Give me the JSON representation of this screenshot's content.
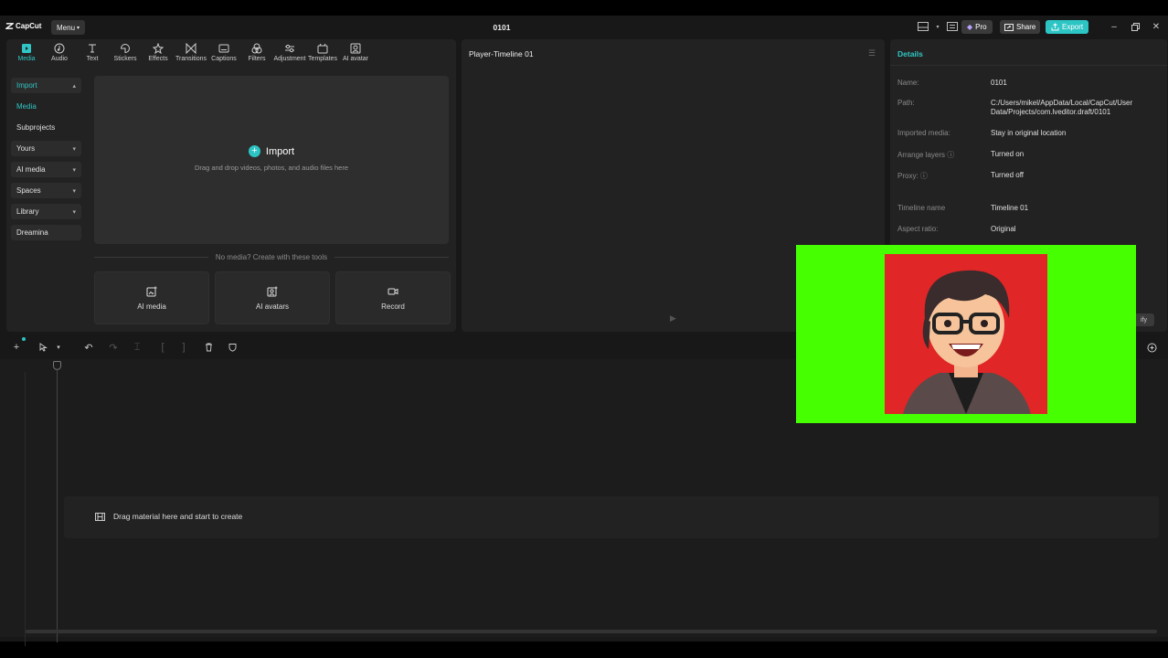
{
  "app": {
    "logo_text": "CapCut",
    "menu_label": "Menu",
    "project_title": "0101",
    "pro_label": "Pro",
    "share_label": "Share",
    "export_label": "Export"
  },
  "toolbar": {
    "items": [
      {
        "label": "Media",
        "icon": "media-icon"
      },
      {
        "label": "Audio",
        "icon": "audio-icon"
      },
      {
        "label": "Text",
        "icon": "text-icon"
      },
      {
        "label": "Stickers",
        "icon": "stickers-icon"
      },
      {
        "label": "Effects",
        "icon": "effects-icon"
      },
      {
        "label": "Transitions",
        "icon": "transitions-icon"
      },
      {
        "label": "Captions",
        "icon": "captions-icon"
      },
      {
        "label": "Filters",
        "icon": "filters-icon"
      },
      {
        "label": "Adjustment",
        "icon": "adjustment-icon"
      },
      {
        "label": "Templates",
        "icon": "templates-icon"
      },
      {
        "label": "AI avatar",
        "icon": "ai-avatar-icon"
      }
    ]
  },
  "sidebar": {
    "items": [
      {
        "label": "Import"
      },
      {
        "label": "Media"
      },
      {
        "label": "Subprojects"
      },
      {
        "label": "Yours"
      },
      {
        "label": "AI media"
      },
      {
        "label": "Spaces"
      },
      {
        "label": "Library"
      },
      {
        "label": "Dreamina"
      }
    ]
  },
  "media": {
    "import_label": "Import",
    "drop_hint": "Drag and drop videos, photos, and audio files here",
    "no_media": "No media? Create with these tools",
    "tools": [
      {
        "label": "AI media"
      },
      {
        "label": "AI avatars"
      },
      {
        "label": "Record"
      }
    ]
  },
  "player": {
    "title": "Player-Timeline 01"
  },
  "details": {
    "title": "Details",
    "rows": [
      {
        "key": "Name:",
        "value": "0101"
      },
      {
        "key": "Path:",
        "value": "C:/Users/mikel/AppData/Local/CapCut/User Data/Projects/com.lveditor.draft/0101"
      },
      {
        "key": "Imported media:",
        "value": "Stay in original location"
      },
      {
        "key": "Arrange layers",
        "value": "Turned on"
      },
      {
        "key": "Proxy:",
        "value": "Turned off"
      },
      {
        "key": "Timeline name",
        "value": "Timeline 01"
      },
      {
        "key": "Aspect ratio:",
        "value": "Original"
      }
    ],
    "modify_label": "ify"
  },
  "timeline": {
    "drop_label": "Drag material here and start to create"
  },
  "colors": {
    "accent": "#2dc4c4",
    "chroma_green": "#46ff00",
    "portrait_bg": "#e02626"
  }
}
